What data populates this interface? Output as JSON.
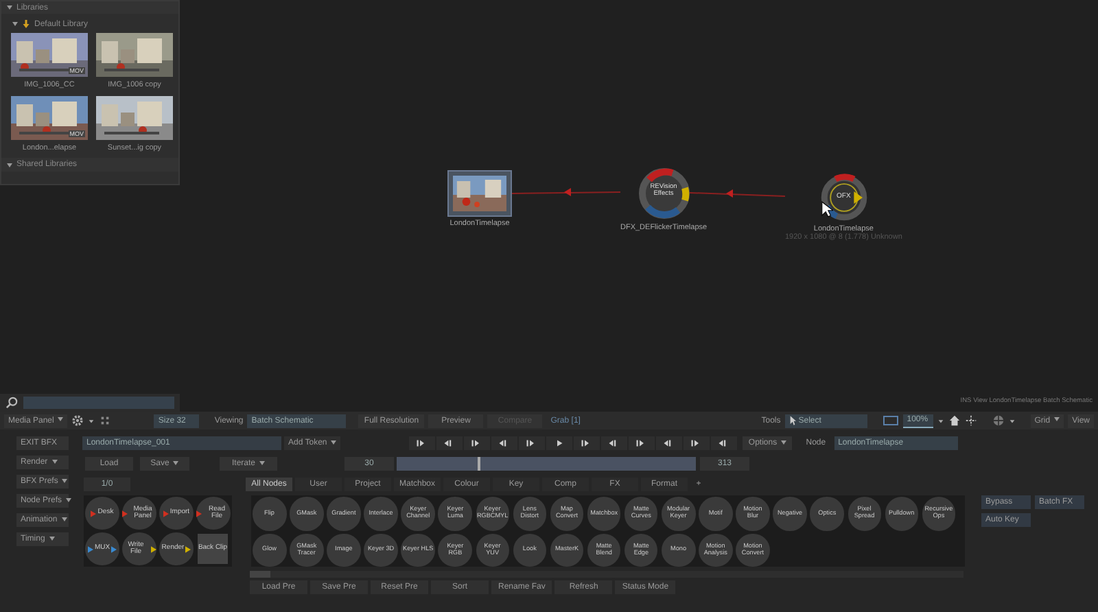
{
  "libraries": {
    "title": "Libraries",
    "expanded": true,
    "default_library": {
      "title": "Default Library",
      "expanded": true,
      "clips": [
        {
          "name": "IMG_1006_CC",
          "badge": "MOV"
        },
        {
          "name": "IMG_1006 copy"
        },
        {
          "name": "London...elapse",
          "badge": "MOV"
        },
        {
          "name": "Sunset...ig copy"
        }
      ]
    },
    "shared_library": {
      "title": "Shared Libraries",
      "expanded": true
    }
  },
  "status_text": "INS View LondonTimelapse Batch Schematic",
  "schematic": {
    "nodes": [
      {
        "kind": "clip",
        "label": "LondonTimelapse"
      },
      {
        "kind": "effect",
        "title": "REVision Effects",
        "label": "DFX_DEFlickerTimelapse"
      },
      {
        "kind": "output",
        "title": "OFX",
        "label": "LondonTimelapse",
        "info": "1920 x 1080 @ 8 (1.778) Unknown"
      }
    ]
  },
  "toolbar": {
    "media_panel": "Media Panel",
    "size": "Size 32",
    "viewing_label": "Viewing",
    "viewing": "Batch Schematic",
    "resolution": "Full Resolution",
    "preview": {
      "label": "Preview",
      "disabled": false
    },
    "compare": {
      "label": "Compare",
      "disabled": true
    },
    "grab": "Grab [1]",
    "tools_label": "Tools",
    "tool": "Select",
    "zoom": "100%",
    "grid": "Grid",
    "view": "View"
  },
  "side_buttons": [
    {
      "label": "EXIT BFX",
      "dropdown": false
    },
    {
      "label": "Render",
      "dropdown": true
    },
    {
      "label": "BFX Prefs",
      "dropdown": true
    },
    {
      "label": "Node Prefs",
      "dropdown": true
    },
    {
      "label": "Animation",
      "dropdown": true
    },
    {
      "label": "Timing",
      "dropdown": true
    }
  ],
  "setup": {
    "name": "LondonTimelapse_001",
    "add_token": "Add Token",
    "load": "Load",
    "save": "Save",
    "iterate": "Iterate",
    "count": "1/0"
  },
  "timeline": {
    "start_frame": "30",
    "end_frame": "313",
    "level": 0.27,
    "options": "Options",
    "node_label": "Node",
    "node_name": "LondonTimelapse"
  },
  "io_nodes": [
    {
      "label": "Desk",
      "kind": "input"
    },
    {
      "label": "Media Panel",
      "kind": "input"
    },
    {
      "label": "Import",
      "kind": "input"
    },
    {
      "label": "Read File",
      "kind": "input"
    },
    {
      "label": "MUX",
      "kind": "mux"
    },
    {
      "label": "Write File",
      "kind": "output"
    },
    {
      "label": "Render",
      "kind": "output"
    },
    {
      "label": "Back Clip",
      "kind": "square"
    }
  ],
  "tabs": [
    {
      "label": "All Nodes",
      "selected": true
    },
    {
      "label": "User",
      "selected": false
    },
    {
      "label": "Project",
      "selected": false
    },
    {
      "label": "Matchbox",
      "selected": false
    },
    {
      "label": "Colour",
      "selected": false
    },
    {
      "label": "Key",
      "selected": false
    },
    {
      "label": "Comp",
      "selected": false
    },
    {
      "label": "FX",
      "selected": false
    },
    {
      "label": "Format",
      "selected": false
    },
    {
      "label": "+",
      "selected": false
    }
  ],
  "nodes_row_1": [
    "Flip",
    "GMask",
    "Gradient",
    "Interlace",
    "Keyer Channel",
    "Keyer Luma",
    "Keyer RGBCMYL",
    "Lens Distort",
    "Map Convert",
    "Matchbox",
    "Matte Curves",
    "Modular Keyer",
    "Motif",
    "Motion Blur",
    "Negative",
    "Optics",
    "Pixel Spread",
    "Pulldown",
    "Recursive Ops"
  ],
  "nodes_row_2": [
    "Glow",
    "GMask Tracer",
    "Image",
    "Keyer 3D",
    "Keyer HLS",
    "Keyer RGB",
    "Keyer YUV",
    "Look",
    "MasterK",
    "Matte Blend",
    "Matte Edge",
    "Mono",
    "Motion Analysis",
    "Motion Convert"
  ],
  "right_buttons": [
    {
      "label": "Bypass",
      "selected": false
    },
    {
      "label": "Batch FX",
      "selected": false
    },
    {
      "label": "Auto Key",
      "selected": false
    }
  ],
  "bottom_buttons": [
    "Load Pre",
    "Save Pre",
    "Reset Pre",
    "Sort",
    "Rename Fav",
    "Refresh",
    "Status Mode"
  ]
}
